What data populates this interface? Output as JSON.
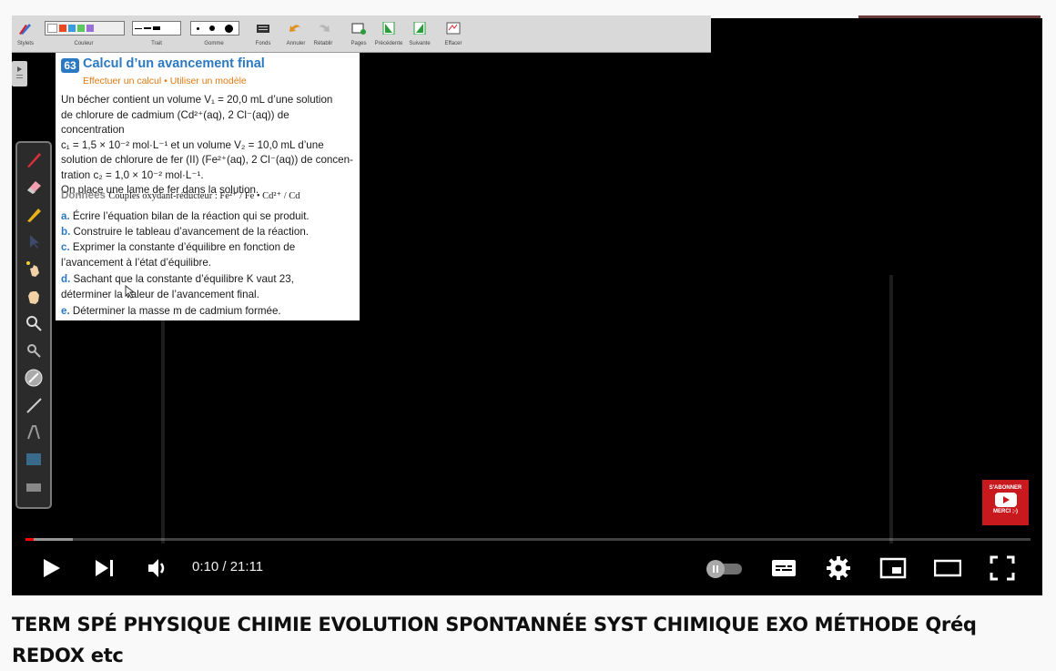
{
  "toolbar": {
    "stylets_label": "Stylets",
    "couleur_label": "Couleur",
    "trait_label": "Trait",
    "gomme_label": "Gomme",
    "fonds_label": "Fonds",
    "annuler_label": "Annuler",
    "retablir_label": "Rétablir",
    "pages_label": "Pages",
    "precedente_label": "Précédente",
    "suivante_label": "Suivante",
    "effacer_label": "Effacer",
    "colors": [
      "#ffffff",
      "#e8471f",
      "#3a9bdc",
      "#5cc85c",
      "#9b6fd8"
    ]
  },
  "exercise": {
    "number": "63",
    "title": "Calcul d’un avancement final",
    "subtitle": "Effectuer un calcul • Utiliser un modèle",
    "paragraph_lines": [
      "Un bécher contient un volume V₁ = 20,0 mL d’une solution",
      "de chlorure de cadmium (Cd²⁺(aq), 2 Cl⁻(aq)) de concentration",
      "c₁ = 1,5 × 10⁻² mol·L⁻¹ et un volume V₂ = 10,0 mL d’une",
      "solution de chlorure de fer (II) (Fe²⁺(aq), 2 Cl⁻(aq)) de concen-",
      "tration c₂ = 1,0 × 10⁻² mol·L⁻¹.",
      "On place une lame de fer dans la solution."
    ],
    "donnees_label": "Données",
    "donnees_text": "Couples oxydant-réducteur : Fe²⁺ / Fe • Cd²⁺ / Cd",
    "questions": [
      {
        "letter": "a.",
        "lines": [
          "Écrire l’équation bilan de la réaction qui se produit."
        ]
      },
      {
        "letter": "b.",
        "lines": [
          "Construire le tableau d’avancement de la réaction."
        ]
      },
      {
        "letter": "c.",
        "lines": [
          "Exprimer la constante d’équilibre en fonction de",
          "l’avancement à l’état d’équilibre."
        ]
      },
      {
        "letter": "d.",
        "lines": [
          "Sachant que la constante d’équilibre K vaut 23,",
          "déterminer la valeur de l’avancement final."
        ]
      },
      {
        "letter": "e.",
        "lines": [
          "Déterminer la masse m de cadmium formée."
        ]
      }
    ]
  },
  "subscribe": {
    "line1": "S'ABONNER",
    "line2": "MERCI ;-)"
  },
  "player": {
    "time": "0:10 / 21:11",
    "progress_played_fraction": 0.0003,
    "accent": "#ff0000"
  },
  "video_title": "TERM SPÉ PHYSIQUE CHIMIE EVOLUTION SPONTANNÉE SYST CHIMIQUE EXO MÉTHODE Qréq REDOX etc"
}
